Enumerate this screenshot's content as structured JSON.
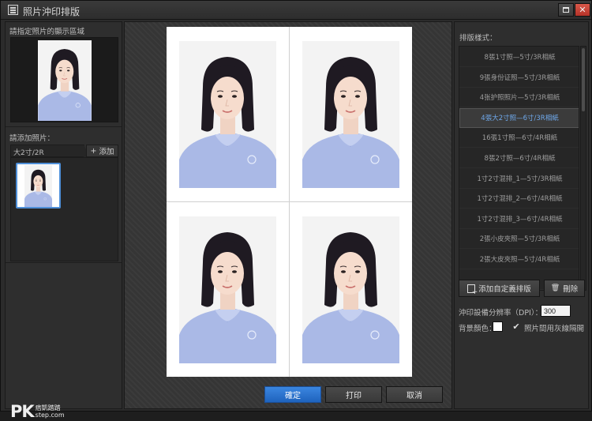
{
  "window": {
    "title": "照片沖印排版"
  },
  "left_panel": {
    "display_area_label": "請指定照片的顯示區域",
    "add_photo_label": "請添加照片：",
    "size_tab_label": "大2寸/2R",
    "add_button_label": "添加",
    "add_icon_glyph": "+"
  },
  "center": {
    "confirm_label": "確定",
    "print_label": "打印",
    "cancel_label": "取消"
  },
  "right_panel": {
    "layout_label": "排版樣式：",
    "layout_items": [
      "8張1寸照—5寸/3R相紙",
      "9張身份证照—5寸/3R相紙",
      "4张护照照片—5寸/3R相紙",
      "4張大2寸照—6寸/3R相紙",
      "16張1寸照—6寸/4R相紙",
      "8張2寸照—6寸/4R相紙",
      "1寸2寸混排_1—5寸/3R相紙",
      "1寸2寸混排_2—6寸/4R相紙",
      "1寸2寸混排_3—6寸/4R相紙",
      "2張小皮夾照—5寸/3R相紙",
      "2張大皮夾照—5寸/4R相紙"
    ],
    "selected_index": 3,
    "add_custom_label": "添加自定義排版",
    "delete_label": "刪除",
    "dpi_label": "沖印設備分辨率（DPI）：",
    "dpi_value": "300",
    "bg_color_label": "背景顏色：",
    "bg_color_value": "#ffffff",
    "gray_separator_label": "照片間用灰線隔開",
    "gray_separator_checked": true
  },
  "watermark": {
    "logo": "PK",
    "line1": "痞凱踏踏",
    "line2": "step.com"
  },
  "colors": {
    "accent": "#2a72d0",
    "selected_text": "#6fa9ec",
    "panel_bg": "#2e2e2e",
    "shirt": "#aab9e6"
  }
}
